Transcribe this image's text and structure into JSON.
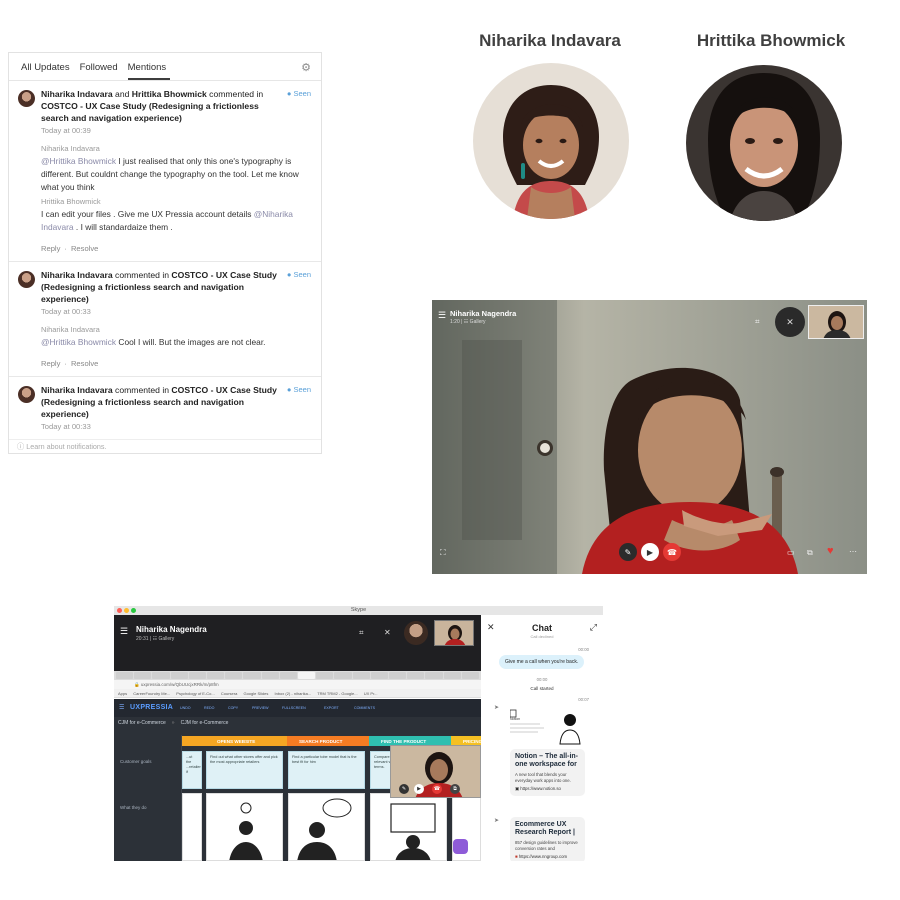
{
  "notifications": {
    "tabs": [
      "All Updates",
      "Followed",
      "Mentions"
    ],
    "active_tab": "Mentions",
    "icons": {
      "settings": "gear-icon",
      "help": "question-circle-icon"
    },
    "items": [
      {
        "author1": "Niharika Indavara",
        "joiner": "and",
        "author2": "Hrittika Bhowmick",
        "verb": "commented in",
        "doc": "COSTCO - UX Case Study (Redesigning a frictionless search and navigation experience)",
        "status": "● Seen",
        "time": "Today at 00:39",
        "replies": [
          {
            "author": "Niharika Indavara",
            "mention": "@Hrittika Bhowmick",
            "text": " I just realised that only this one's typography is different. But couldnt change the typography on the tool. Let me know what you think"
          },
          {
            "author": "Hrittika Bhowmick",
            "pre": "I can edit your files . Give me UX Pressia account details ",
            "mention": "@Niharika Indavara",
            "post": " . I will standardaize them ."
          }
        ],
        "reply_label": "Reply",
        "resolve_label": "Resolve"
      },
      {
        "author1": "Niharika Indavara",
        "verb": "commented in",
        "doc": "COSTCO - UX Case Study (Redesigning a frictionless search and navigation experience)",
        "status": "● Seen",
        "time": "Today at 00:33",
        "replies": [
          {
            "author": "Niharika Indavara",
            "mention": "@Hrittika Bhowmick",
            "text": "  Cool I will. But the images are not clear."
          }
        ],
        "reply_label": "Reply",
        "resolve_label": "Resolve"
      },
      {
        "author1": "Niharika Indavara",
        "verb": "commented in",
        "doc": "COSTCO - UX Case Study (Redesigning a frictionless search and navigation experience)",
        "status": "● Seen",
        "time": "Today at 00:33"
      }
    ],
    "footer": "Learn about notifications."
  },
  "people": [
    {
      "name": "Niharika Indavara"
    },
    {
      "name": "Hrittika Bhowmick"
    }
  ],
  "video_call": {
    "name": "Niharika Nagendra",
    "subtitle": "1:20 | ☷ Gallery",
    "icons": [
      "menu-icon",
      "crop-icon",
      "mic-off-icon",
      "expand-icon",
      "mute-icon",
      "camera-icon",
      "hangup-icon",
      "chat-icon",
      "share-icon",
      "heart-icon",
      "more-icon"
    ],
    "accent": "#e53935"
  },
  "skype": {
    "window_title": "Skype",
    "name": "Niharika Nagendra",
    "subtitle": "20:31 | ☷ Gallery",
    "browser": {
      "url": "uxpressia.com/w/QbUUcjxRRk/m/p8fm",
      "bookmarks": [
        "Apps",
        "CareerFoundry Me...",
        "Psychology of E-Co...",
        "Coursera",
        "Google Slides",
        "Inbox (2) - niharika...",
        "TRM TRM2 - Google...",
        "UX Pr..."
      ]
    },
    "uxpressia": {
      "logo": "UXPRESSIA",
      "toolbar": [
        "UNDO",
        "REDO",
        "COPY",
        "PREVIEW",
        "FULLSCREEN",
        "EXPORT",
        "COMMENTS"
      ],
      "breadcrumb1": "CJM for e-Commerce",
      "breadcrumb2": "CJM for e-Commerce",
      "row_labels": [
        "Customer goals",
        "What they do"
      ],
      "stages": [
        {
          "label": "OPENS WEBSITE",
          "color": "#f5a623"
        },
        {
          "label": "SEARCH PRODUCT",
          "color": "#f57c23"
        },
        {
          "label": "FIND THE PRODUCT",
          "color": "#2fbfb0"
        },
        {
          "label": "PRICING",
          "color": "#f5c023"
        }
      ],
      "cards": [
        "...ut the ...retailer if",
        "Find out what other stores offer and pick the most appropriate retailers",
        "Find a particular tobe model that is the best fit for him",
        "Compare different offers across other relevant websites and find the best terms.",
        "Compare th... retailers and f..."
      ]
    },
    "chat": {
      "title": "Chat",
      "faded": "Call declined",
      "messages": [
        {
          "time": "00:00",
          "text": "Give me a call when you're back."
        },
        {
          "time": "00:00",
          "center": "Call started"
        },
        {
          "time": "00:07"
        }
      ],
      "cards": [
        {
          "title": "Notion – The all-in-one workspace for",
          "desc": "A new tool that blends your everyday work apps into one.",
          "link": "https://www.notion.so"
        },
        {
          "title": "Ecommerce UX Research Report |",
          "desc": "857 design guidelines to improve conversion rates and",
          "link": "https://www.nngroup.com"
        }
      ],
      "preview_caption": "Notion"
    }
  }
}
